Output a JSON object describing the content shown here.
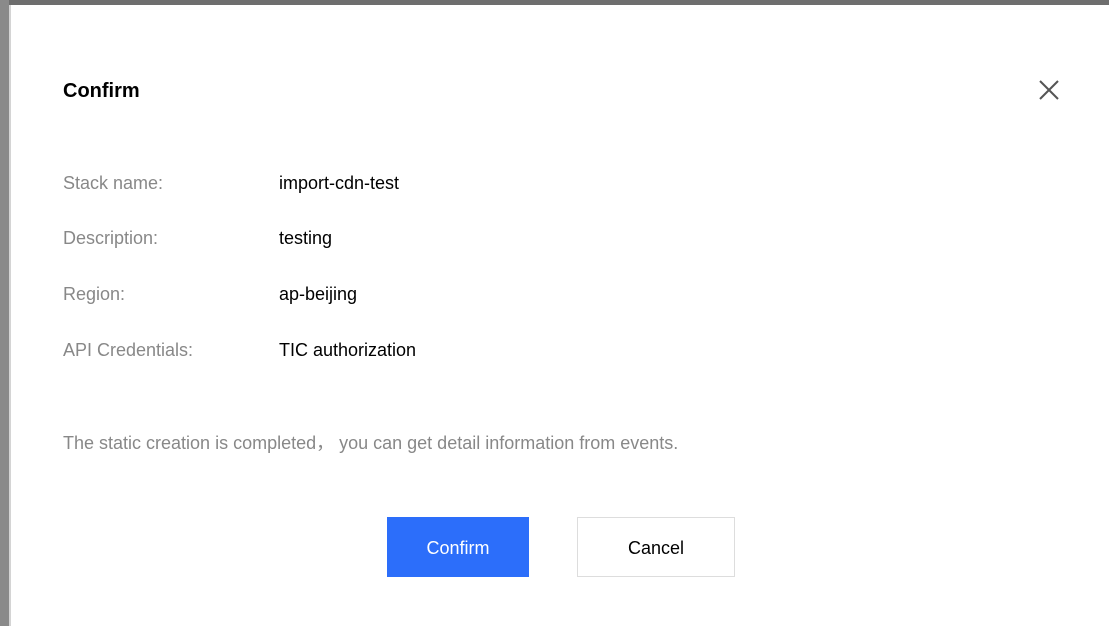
{
  "dialog": {
    "title": "Confirm",
    "close_icon": "close-icon",
    "fields": [
      {
        "label": "Stack name:",
        "value": "import-cdn-test"
      },
      {
        "label": "Description:",
        "value": "testing"
      },
      {
        "label": "Region:",
        "value": "ap-beijing"
      },
      {
        "label": "API Credentials:",
        "value": "TIC authorization"
      }
    ],
    "message": "The static creation is completed， you can get detail information from events.",
    "confirm_label": "Confirm",
    "cancel_label": "Cancel"
  },
  "colors": {
    "primary": "#2c6efa",
    "label_gray": "#888888",
    "text": "#000000",
    "border": "#dddddd"
  }
}
